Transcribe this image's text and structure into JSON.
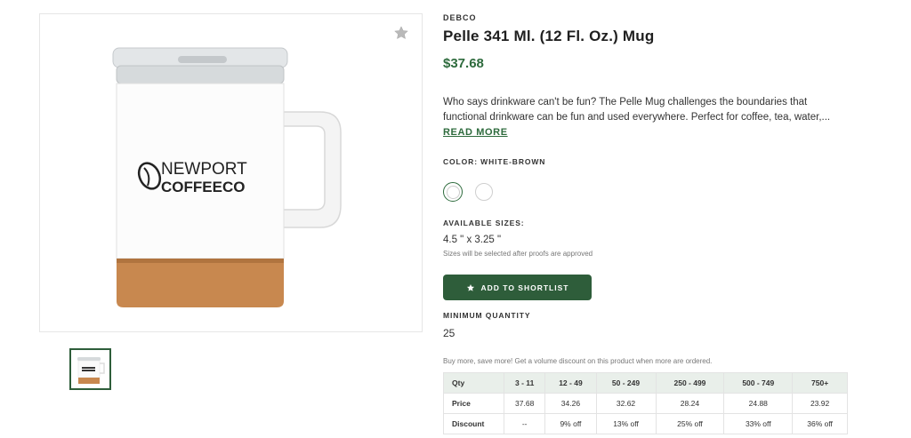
{
  "product": {
    "brand": "DEBCO",
    "title": "Pelle 341 Ml. (12 Fl. Oz.) Mug",
    "price": "$37.68",
    "description": "Who says drinkware can't be fun? The Pelle Mug challenges the boundaries that functional drinkware can be fun and used everywhere. Perfect for coffee, tea, water,...",
    "read_more": "READ MORE",
    "imprint_line1": "NEWPORT",
    "imprint_line2": "COFFEECO"
  },
  "color": {
    "label": "COLOR: WHITE-BROWN",
    "swatches": [
      "white-brown",
      "white"
    ]
  },
  "sizes": {
    "label": "AVAILABLE SIZES:",
    "value": "4.5 \" x 3.25 \"",
    "note": "Sizes will be selected after proofs are approved"
  },
  "shortlist": {
    "label": "ADD TO SHORTLIST",
    "icon": "star-icon"
  },
  "minimum": {
    "label": "MINIMUM QUANTITY",
    "value": "25"
  },
  "pricing": {
    "note": "Buy more, save more! Get a volume discount on this product when more are ordered.",
    "headers": [
      "Qty",
      "3 - 11",
      "12 - 49",
      "50 - 249",
      "250 - 499",
      "500 - 749",
      "750+"
    ],
    "price_row": [
      "Price",
      "37.68",
      "34.26",
      "32.62",
      "28.24",
      "24.88",
      "23.92"
    ],
    "discount_row": [
      "Discount",
      "--",
      "9% off",
      "13% off",
      "25% off",
      "33% off",
      "36% off"
    ]
  },
  "colors": {
    "accent": "#2e6b3d",
    "button": "#2e5d3a",
    "table_header": "#e9efea"
  }
}
